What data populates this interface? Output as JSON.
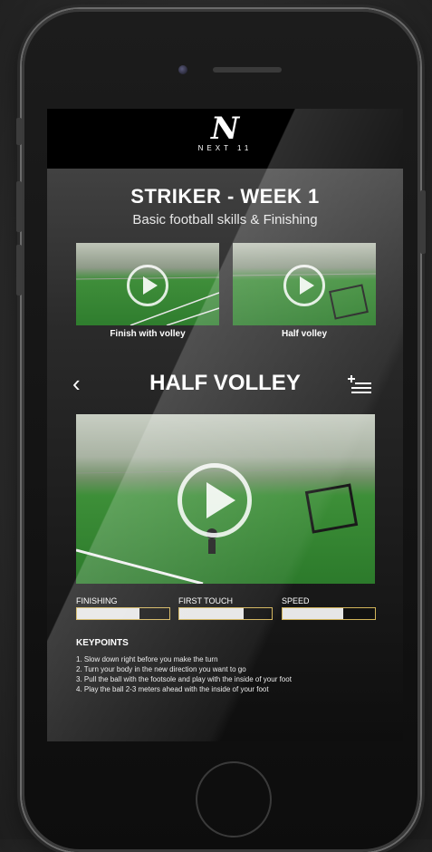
{
  "brand": {
    "mark": "N",
    "name": "NEXT 11"
  },
  "program": {
    "title": "STRIKER - WEEK 1",
    "subtitle": "Basic football skills & Finishing"
  },
  "thumbnails": [
    {
      "caption": "Finish with volley"
    },
    {
      "caption": "Half volley"
    }
  ],
  "drill": {
    "back_icon": "chevron-left-icon",
    "title": "HALF VOLLEY",
    "add_icon": "add-to-list-icon"
  },
  "stats": [
    {
      "label": "FINISHING",
      "level": 0.68
    },
    {
      "label": "FIRST TOUCH",
      "level": 0.7
    },
    {
      "label": "SPEED",
      "level": 0.66
    }
  ],
  "keypoints": {
    "title": "KEYPOINTS",
    "items": [
      "1. Slow down right before you make the turn",
      "2. Turn your body in the new direction you want to go",
      "3. Pull the ball with the footsole and play with the inside of your foot",
      "4. Play the ball 2-3 meters ahead with the inside of your foot"
    ]
  },
  "colors": {
    "accent": "#d2b45a",
    "text": "#ffffff",
    "pitch": "#2f7d2e"
  }
}
